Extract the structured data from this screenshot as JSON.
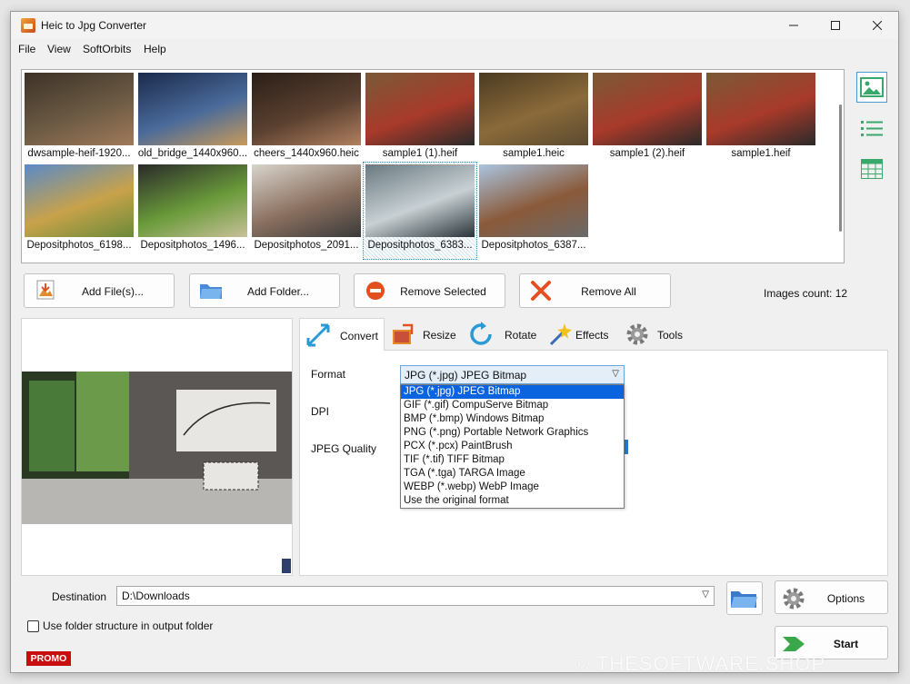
{
  "window": {
    "title": "Heic to Jpg Converter"
  },
  "menu": [
    "File",
    "View",
    "SoftOrbits",
    "Help"
  ],
  "thumbnails": [
    {
      "caption": "dwsample-heif-1920...",
      "colors": [
        "#3d3228",
        "#6b5a44",
        "#a07a5a"
      ]
    },
    {
      "caption": "old_bridge_1440x960...",
      "colors": [
        "#1b2a4a",
        "#4a6a9a",
        "#c99a5a"
      ]
    },
    {
      "caption": "cheers_1440x960.heic",
      "colors": [
        "#2a1f18",
        "#5a4030",
        "#b08060"
      ]
    },
    {
      "caption": "sample1 (1).heif",
      "colors": [
        "#7a5a38",
        "#a83a2a",
        "#2a2a2a"
      ]
    },
    {
      "caption": "sample1.heic",
      "colors": [
        "#4a3a22",
        "#8a6a3a",
        "#5a4a30"
      ]
    },
    {
      "caption": "sample1 (2).heif",
      "colors": [
        "#7a5a38",
        "#a83a2a",
        "#2a2a2a"
      ]
    },
    {
      "caption": "sample1.heif",
      "colors": [
        "#7a5a38",
        "#a83a2a",
        "#2a2a2a"
      ]
    },
    {
      "caption": "Depositphotos_6198...",
      "colors": [
        "#5a8ac8",
        "#c8a24a",
        "#6a8a3a"
      ]
    },
    {
      "caption": "Depositphotos_1496...",
      "colors": [
        "#2a2a2a",
        "#6a9a3a",
        "#c8c09a"
      ]
    },
    {
      "caption": "Depositphotos_2091...",
      "colors": [
        "#d8d4cc",
        "#8a7060",
        "#3a3a3a"
      ]
    },
    {
      "caption": "Depositphotos_6383...",
      "colors": [
        "#6a7a80",
        "#c8d0d4",
        "#2a3438"
      ]
    },
    {
      "caption": "Depositphotos_6387...",
      "colors": [
        "#aac4e0",
        "#8a5a3a",
        "#6a6a6a"
      ]
    }
  ],
  "actions": {
    "add_files": "Add File(s)...",
    "add_folder": "Add Folder...",
    "remove_selected": "Remove Selected",
    "remove_all": "Remove All"
  },
  "images_count": "Images count: 12",
  "tabs": [
    "Convert",
    "Resize",
    "Rotate",
    "Effects",
    "Tools"
  ],
  "convert": {
    "format_label": "Format",
    "dpi_label": "DPI",
    "quality_label": "JPEG Quality",
    "format_value": "JPG (*.jpg) JPEG Bitmap",
    "format_options": [
      "JPG (*.jpg) JPEG Bitmap",
      "GIF (*.gif) CompuServe Bitmap",
      "BMP (*.bmp) Windows Bitmap",
      "PNG (*.png) Portable Network Graphics",
      "PCX (*.pcx) PaintBrush",
      "TIF (*.tif) TIFF Bitmap",
      "TGA (*.tga) TARGA Image",
      "WEBP (*.webp) WebP Image",
      "Use the original format"
    ]
  },
  "destination": {
    "label": "Destination",
    "value": "D:\\Downloads"
  },
  "options_label": "Options",
  "start_label": "Start",
  "folder_structure_label": "Use folder structure in output folder",
  "promo": "PROMO",
  "watermark": "© THESOFTWARE.SHOP"
}
